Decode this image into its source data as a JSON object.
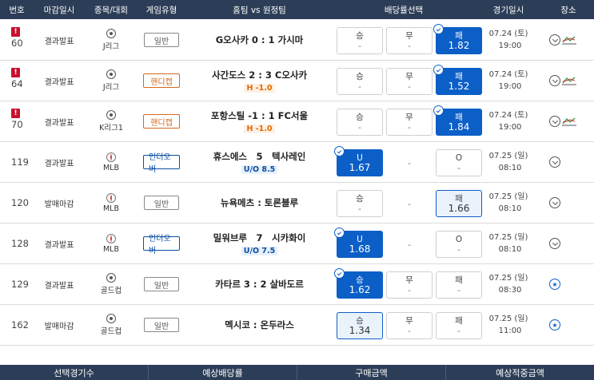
{
  "headers": {
    "no": "번호",
    "deadline": "마감일시",
    "sport": "종목/대회",
    "game_type": "게임유형",
    "teams": "홈팀 vs 원정팀",
    "odds": "배당률선택",
    "date": "경기일시",
    "place": "장소"
  },
  "colors": {
    "header_bg": "#2c3e57",
    "selected": "#0b5fc7",
    "handicap": "#e06a00",
    "alert": "#c8102e"
  },
  "rows": [
    {
      "no": "60",
      "alert": "!",
      "deadline": "결과발표",
      "sport": "J리그",
      "sport_icon": "soccer-icon",
      "game_type": "일반",
      "type": "normal",
      "teams": "G오사카 0 : 1 가시마",
      "sub": "",
      "odds": [
        {
          "label": "승",
          "value": "-"
        },
        {
          "label": "무",
          "value": "-"
        },
        {
          "label": "패",
          "value": "1.82"
        }
      ],
      "selected": 2,
      "date": "07.24 (토)",
      "time": "19:00",
      "trend": true
    },
    {
      "no": "64",
      "alert": "!",
      "deadline": "결과발표",
      "sport": "J리그",
      "sport_icon": "soccer-icon",
      "game_type": "핸디캡",
      "type": "handi",
      "teams": "사간도스 2 : 3 C오사카",
      "sub": "H -1.0",
      "odds": [
        {
          "label": "승",
          "value": "-"
        },
        {
          "label": "무",
          "value": "-"
        },
        {
          "label": "패",
          "value": "1.52"
        }
      ],
      "selected": 2,
      "date": "07.24 (토)",
      "time": "19:00",
      "trend": true
    },
    {
      "no": "70",
      "alert": "!",
      "deadline": "결과발표",
      "sport": "K리그1",
      "sport_icon": "soccer-icon",
      "game_type": "핸디캡",
      "type": "handi",
      "teams": "포항스틸 -1 : 1 FC서울",
      "sub": "H -1.0",
      "odds": [
        {
          "label": "승",
          "value": "-"
        },
        {
          "label": "무",
          "value": "-"
        },
        {
          "label": "패",
          "value": "1.84"
        }
      ],
      "selected": 2,
      "date": "07.24 (토)",
      "time": "19:00",
      "trend": true
    },
    {
      "no": "119",
      "alert": "",
      "deadline": "결과발표",
      "sport": "MLB",
      "sport_icon": "baseball-icon",
      "game_type": "언더오버",
      "type": "uo",
      "teams": "휴스에스　5　텍사레인",
      "sub": "U/O 8.5",
      "odds": [
        {
          "label": "U",
          "value": "1.67"
        },
        {
          "label": "",
          "value": "-"
        },
        {
          "label": "O",
          "value": "-"
        }
      ],
      "selected": 0,
      "date": "07.25 (일)",
      "time": "08:10",
      "trend": false
    },
    {
      "no": "120",
      "alert": "",
      "deadline": "발매마감",
      "sport": "MLB",
      "sport_icon": "baseball-icon",
      "game_type": "일반",
      "type": "normal",
      "teams": "뉴욕메츠 : 토론블루",
      "sub": "",
      "odds": [
        {
          "label": "승",
          "value": "-"
        },
        {
          "label": "",
          "value": "-"
        },
        {
          "label": "패",
          "value": "1.66"
        }
      ],
      "selected": -1,
      "highlight": 2,
      "date": "07.25 (일)",
      "time": "08:10",
      "trend": false
    },
    {
      "no": "128",
      "alert": "",
      "deadline": "결과발표",
      "sport": "MLB",
      "sport_icon": "baseball-icon",
      "game_type": "언더오버",
      "type": "uo",
      "teams": "밀워브루　7　시카화이",
      "sub": "U/O 7.5",
      "odds": [
        {
          "label": "U",
          "value": "1.68"
        },
        {
          "label": "",
          "value": "-"
        },
        {
          "label": "O",
          "value": "-"
        }
      ],
      "selected": 0,
      "date": "07.25 (일)",
      "time": "08:10",
      "trend": false
    },
    {
      "no": "129",
      "alert": "",
      "deadline": "결과발표",
      "sport": "골드컵",
      "sport_icon": "soccer-icon",
      "game_type": "일반",
      "type": "normal",
      "teams": "카타르 3 : 2 살바도르",
      "sub": "",
      "odds": [
        {
          "label": "승",
          "value": "1.62"
        },
        {
          "label": "무",
          "value": "-"
        },
        {
          "label": "패",
          "value": "-"
        }
      ],
      "selected": 0,
      "date": "07.25 (일)",
      "time": "08:30",
      "trend": false,
      "star": true
    },
    {
      "no": "162",
      "alert": "",
      "deadline": "발매마감",
      "sport": "골드컵",
      "sport_icon": "soccer-icon",
      "game_type": "일반",
      "type": "normal",
      "teams": "멕시코 : 온두라스",
      "sub": "",
      "odds": [
        {
          "label": "승",
          "value": "1.34"
        },
        {
          "label": "무",
          "value": "-"
        },
        {
          "label": "패",
          "value": "-"
        }
      ],
      "selected": -1,
      "highlight": 0,
      "date": "07.25 (일)",
      "time": "11:00",
      "trend": false,
      "star": true
    }
  ],
  "footer": [
    "선택경기수",
    "예상배당률",
    "구매금액",
    "예상적중금액"
  ]
}
